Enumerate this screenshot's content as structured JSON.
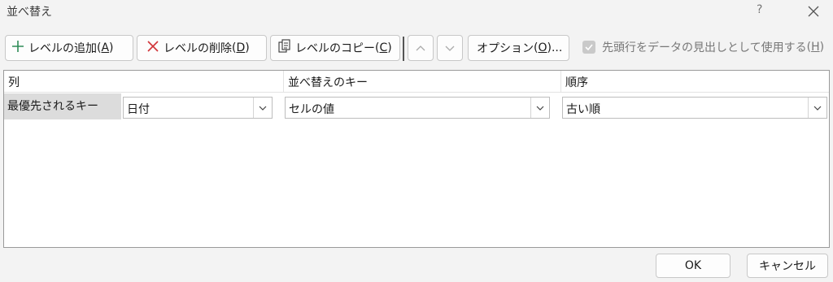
{
  "window": {
    "title": "並べ替え",
    "help": "?"
  },
  "toolbar": {
    "add_level": "レベルの追加",
    "add_level_key": "A",
    "delete_level": "レベルの削除",
    "delete_level_key": "D",
    "copy_level": "レベルのコピー",
    "copy_level_key": "C",
    "options": "オプション",
    "options_key": "O",
    "options_suffix": "...",
    "header_checkbox": "先頭行をデータの見出しとして使用する",
    "header_checkbox_key": "H",
    "header_checkbox_checked": true
  },
  "grid": {
    "headers": {
      "column": "列",
      "sort_on": "並べ替えのキー",
      "order": "順序"
    },
    "rows": [
      {
        "label": "最優先されるキー",
        "column": "日付",
        "sort_on": "セルの値",
        "order": "古い順"
      }
    ]
  },
  "footer": {
    "ok": "OK",
    "cancel": "キャンセル"
  },
  "colors": {
    "add_icon": "#2e8b57",
    "delete_icon": "#d13438"
  }
}
